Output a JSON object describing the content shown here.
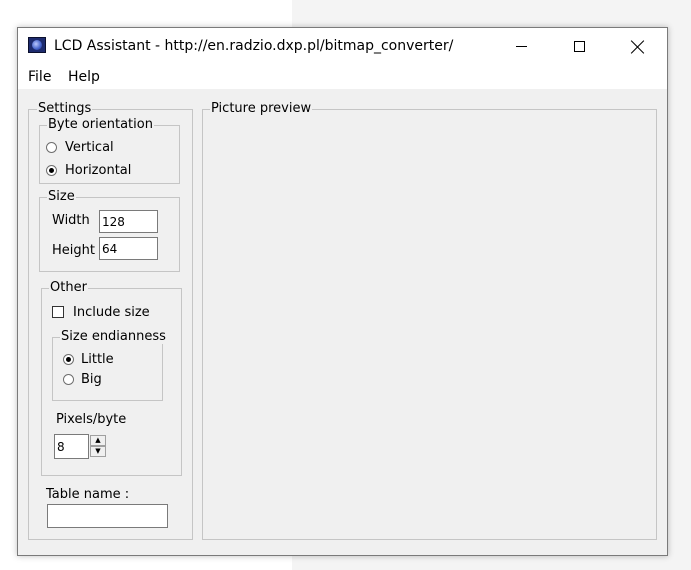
{
  "window": {
    "title": "LCD Assistant -  http://en.radzio.dxp.pl/bitmap_converter/"
  },
  "menu": {
    "file": "File",
    "help": "Help"
  },
  "settings": {
    "legend": "Settings",
    "byte_orientation": {
      "legend": "Byte orientation",
      "vertical": "Vertical",
      "horizontal": "Horizontal",
      "selected": "Horizontal"
    },
    "size": {
      "legend": "Size",
      "width_label": "Width",
      "width_value": "128",
      "height_label": "Height",
      "height_value": "64"
    },
    "other": {
      "legend": "Other",
      "include_size": "Include size",
      "include_size_checked": false,
      "size_endianness": {
        "legend": "Size endianness",
        "little": "Little",
        "big": "Big",
        "selected": "Little"
      },
      "pixels_per_byte_label": "Pixels/byte",
      "pixels_per_byte_value": "8"
    },
    "table_name_label": "Table name :",
    "table_name_value": ""
  },
  "preview": {
    "legend": "Picture preview"
  }
}
